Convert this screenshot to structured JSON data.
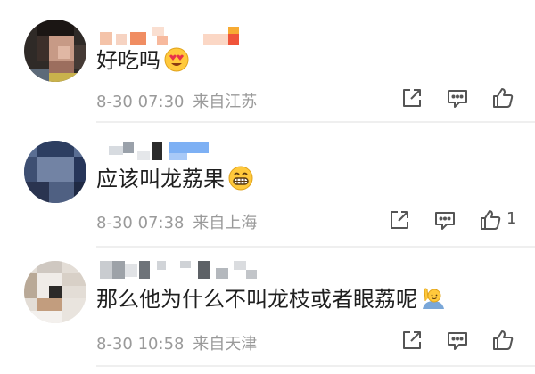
{
  "comments": [
    {
      "text": "好吃吗",
      "emoji_icon": "heart-eyes-emoji-icon",
      "date": "8-30",
      "time": "07:30",
      "location": "来自江苏",
      "like_count": ""
    },
    {
      "text": "应该叫龙荔果",
      "emoji_icon": "grinning-emoji-icon",
      "date": "8-30",
      "time": "07:38",
      "location": "来自上海",
      "like_count": "1"
    },
    {
      "text": "那么他为什么不叫龙枝或者眼荔呢",
      "emoji_icon": "raising-hand-emoji-icon",
      "date": "8-30",
      "time": "10:58",
      "location": "来自天津",
      "like_count": ""
    }
  ],
  "colors": {
    "meta_text": "#9a9a9a",
    "icon_stroke": "#555555",
    "divider": "#efefef"
  }
}
